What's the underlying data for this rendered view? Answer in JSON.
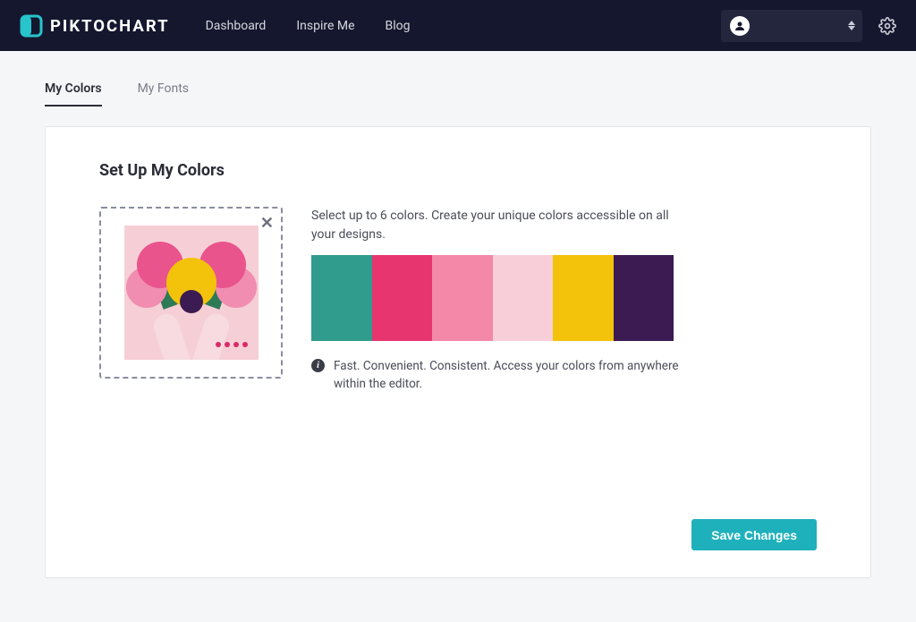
{
  "brand": {
    "name": "PIKTOCHART"
  },
  "nav": {
    "dashboard": "Dashboard",
    "inspire": "Inspire Me",
    "blog": "Blog"
  },
  "tabs": {
    "colors": "My Colors",
    "fonts": "My Fonts",
    "active": "colors"
  },
  "page": {
    "title": "Set Up My Colors",
    "description": "Select up to 6 colors. Create your unique colors accessible on all your designs.",
    "info_text": "Fast. Convenient. Consistent. Access your colors from anywhere within the editor.",
    "save_label": "Save Changes"
  },
  "palette": {
    "colors": [
      "#2f9c8e",
      "#e6356f",
      "#f488a8",
      "#f8cfd8",
      "#f3c30c",
      "#3c1b52"
    ]
  },
  "icons": {
    "close": "✕"
  }
}
